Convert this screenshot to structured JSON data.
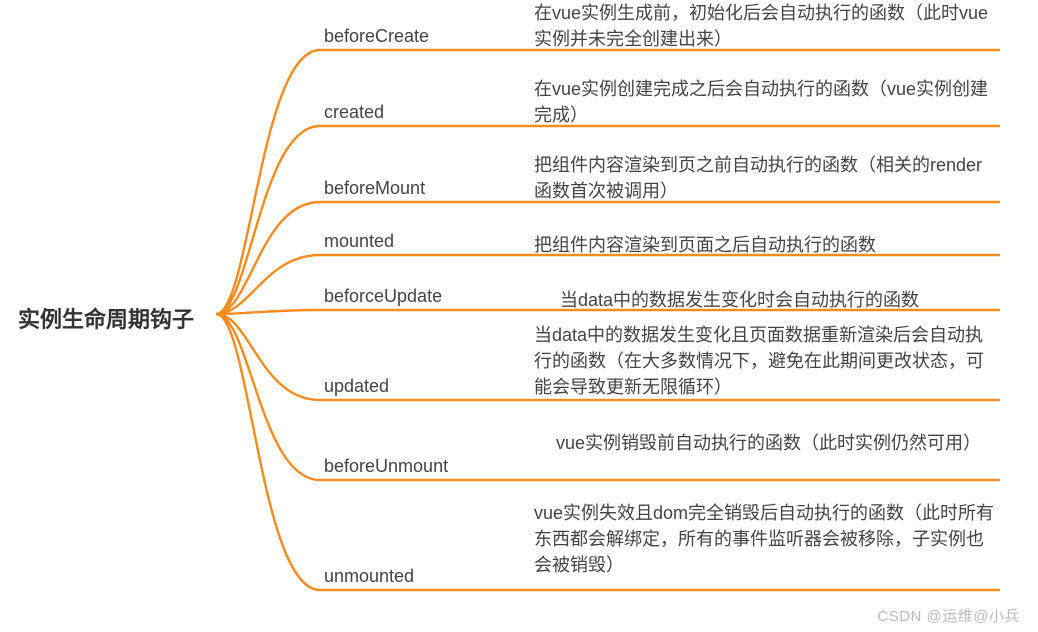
{
  "root": {
    "title": "实例生命周期钩子"
  },
  "hooks": [
    {
      "name": "beforeCreate",
      "desc": "在vue实例生成前，初始化后会自动执行的函数（此时vue实例并未完全创建出来）"
    },
    {
      "name": "created",
      "desc": "在vue实例创建完成之后会自动执行的函数（vue实例创建完成）"
    },
    {
      "name": "beforeMount",
      "desc": "把组件内容渲染到页之前自动执行的函数（相关的render函数首次被调用）"
    },
    {
      "name": "mounted",
      "desc": "把组件内容渲染到页面之后自动执行的函数"
    },
    {
      "name": "beforceUpdate",
      "desc": "当data中的数据发生变化时会自动执行的函数"
    },
    {
      "name": "updated",
      "desc": "当data中的数据发生变化且页面数据重新渲染后会自动执行的函数（在大多数情况下，避免在此期间更改状态，可能会导致更新无限循环）"
    },
    {
      "name": "beforeUnmount",
      "desc": "vue实例销毁前自动执行的函数（此时实例仍然可用）"
    },
    {
      "name": "unmounted",
      "desc": "vue实例失效且dom完全销毁后自动执行的函数（此时所有东西都会解绑定，所有的事件监听器会被移除，子实例也会被销毁）"
    }
  ],
  "watermark": "CSDN @运维@小兵"
}
